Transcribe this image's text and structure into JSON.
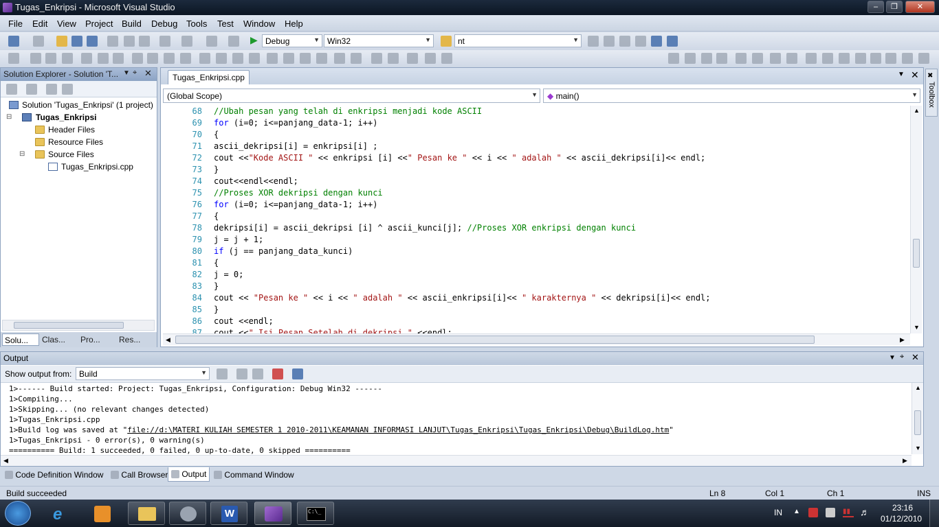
{
  "window": {
    "title": "Tugas_Enkripsi - Microsoft Visual Studio"
  },
  "menu": [
    "File",
    "Edit",
    "View",
    "Project",
    "Build",
    "Debug",
    "Tools",
    "Test",
    "Window",
    "Help"
  ],
  "toolbar": {
    "config": "Debug",
    "platform": "Win32",
    "find": "nt"
  },
  "solution_explorer": {
    "title": "Solution Explorer - Solution 'T...",
    "solution": "Solution 'Tugas_Enkripsi' (1 project)",
    "project": "Tugas_Enkripsi",
    "folders": [
      "Header Files",
      "Resource Files",
      "Source Files"
    ],
    "file": "Tugas_Enkripsi.cpp",
    "tabs": [
      "Solu...",
      "Clas...",
      "Pro...",
      "Res..."
    ]
  },
  "editor": {
    "tab": "Tugas_Enkripsi.cpp",
    "scope": "(Global Scope)",
    "member": "main()",
    "lines": [
      {
        "n": "68",
        "parts": [
          [
            "cm",
            "//Ubah pesan yang telah di enkripsi menjadi kode ASCII"
          ]
        ]
      },
      {
        "n": "69",
        "parts": [
          [
            "kw",
            "for"
          ],
          [
            "tx",
            " (i=0; i<=panjang_data-1; i++)"
          ]
        ]
      },
      {
        "n": "70",
        "parts": [
          [
            "tx",
            "{"
          ]
        ]
      },
      {
        "n": "71",
        "parts": [
          [
            "tx",
            "ascii_dekripsi[i] = enkripsi[i] ;"
          ]
        ]
      },
      {
        "n": "72",
        "parts": [
          [
            "tx",
            "cout <<"
          ],
          [
            "st",
            "\"Kode ASCII \""
          ],
          [
            "tx",
            " << enkripsi [i] <<"
          ],
          [
            "st",
            "\" Pesan ke \""
          ],
          [
            "tx",
            " << i << "
          ],
          [
            "st",
            "\" adalah \""
          ],
          [
            "tx",
            " << ascii_dekripsi[i]<< endl;"
          ]
        ]
      },
      {
        "n": "73",
        "parts": [
          [
            "tx",
            "}"
          ]
        ]
      },
      {
        "n": "74",
        "parts": [
          [
            "tx",
            "cout<<endl<<endl;"
          ]
        ]
      },
      {
        "n": "75",
        "parts": [
          [
            "cm",
            "//Proses XOR dekripsi dengan kunci"
          ]
        ]
      },
      {
        "n": "76",
        "parts": [
          [
            "kw",
            "for"
          ],
          [
            "tx",
            " (i=0; i<=panjang_data-1; i++)"
          ]
        ]
      },
      {
        "n": "77",
        "parts": [
          [
            "tx",
            "{"
          ]
        ]
      },
      {
        "n": "78",
        "parts": [
          [
            "tx",
            "dekripsi[i] = ascii_dekripsi [i] ^ ascii_kunci[j]; "
          ],
          [
            "cm",
            "//Proses XOR enkripsi dengan kunci"
          ]
        ]
      },
      {
        "n": "79",
        "parts": [
          [
            "tx",
            "j = j + 1;"
          ]
        ]
      },
      {
        "n": "80",
        "parts": [
          [
            "kw",
            "if"
          ],
          [
            "tx",
            " (j == panjang_data_kunci)"
          ]
        ]
      },
      {
        "n": "81",
        "parts": [
          [
            "tx",
            "{"
          ]
        ]
      },
      {
        "n": "82",
        "parts": [
          [
            "tx",
            "j = 0;"
          ]
        ]
      },
      {
        "n": "83",
        "parts": [
          [
            "tx",
            "}"
          ]
        ]
      },
      {
        "n": "84",
        "parts": [
          [
            "tx",
            "cout << "
          ],
          [
            "st",
            "\"Pesan ke \""
          ],
          [
            "tx",
            " << i << "
          ],
          [
            "st",
            "\" adalah \""
          ],
          [
            "tx",
            " << ascii_enkripsi[i]<< "
          ],
          [
            "st",
            "\" karakternya \""
          ],
          [
            "tx",
            " << dekripsi[i]<< endl;"
          ]
        ]
      },
      {
        "n": "85",
        "parts": [
          [
            "tx",
            "}"
          ]
        ]
      },
      {
        "n": "86",
        "parts": [
          [
            "tx",
            "cout <<endl;"
          ]
        ]
      },
      {
        "n": "87",
        "parts": [
          [
            "tx",
            "cout <<"
          ],
          [
            "st",
            "\" Isi Pesan Setelah di dekripsi \""
          ],
          [
            "tx",
            " <<endl;"
          ]
        ]
      }
    ]
  },
  "output": {
    "title": "Output",
    "show_label": "Show output from:",
    "source": "Build",
    "lines": [
      "1>------ Build started: Project: Tugas_Enkripsi, Configuration: Debug Win32 ------",
      "1>Compiling...",
      "1>Skipping... (no relevant changes detected)",
      "1>Tugas_Enkripsi.cpp",
      "1>Tugas_Enkripsi - 0 error(s), 0 warning(s)",
      "========== Build: 1 succeeded, 0 failed, 0 up-to-date, 0 skipped =========="
    ],
    "buildlog_prefix": "1>Build log was saved at \"",
    "buildlog_link": "file://d:\\MATERI KULIAH SEMESTER 1 2010-2011\\KEAMANAN INFORMASI LANJUT\\Tugas_Enkripsi\\Tugas_Enkripsi\\Debug\\BuildLog.htm",
    "buildlog_suffix": "\""
  },
  "bottom_tabs": [
    "Code Definition Window",
    "Call Browser",
    "Output",
    "Command Window"
  ],
  "toolbox_label": "Toolbox",
  "status": {
    "message": "Build succeeded",
    "ln": "Ln 8",
    "col": "Col 1",
    "ch": "Ch 1",
    "ins": "INS"
  },
  "taskbar": {
    "lang": "IN",
    "time": "23:16",
    "date": "01/12/2010"
  }
}
